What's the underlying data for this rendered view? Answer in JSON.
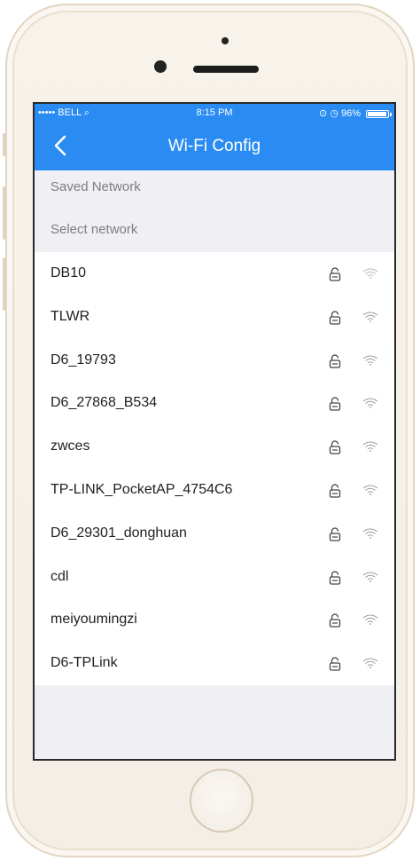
{
  "status_bar": {
    "carrier": "••••• BELL ⌕",
    "time": "8:15 PM",
    "right": "⊙ ◷ 96%"
  },
  "nav": {
    "title": "Wi-Fi Config",
    "back_icon": "chevron-left-icon"
  },
  "sections": {
    "saved": "Saved Network",
    "select": "Select network"
  },
  "networks": [
    {
      "ssid": "DB10"
    },
    {
      "ssid": "TLWR"
    },
    {
      "ssid": "D6_19793"
    },
    {
      "ssid": "D6_27868_B534"
    },
    {
      "ssid": "zwces"
    },
    {
      "ssid": "TP-LINK_PocketAP_4754C6"
    },
    {
      "ssid": "D6_29301_donghuan"
    },
    {
      "ssid": "cdl"
    },
    {
      "ssid": "meiyoumingzi"
    },
    {
      "ssid": "D6-TPLink"
    }
  ],
  "icons": {
    "lock": "lock-icon",
    "wifi": "wifi-icon"
  },
  "colors": {
    "accent": "#2a8cf2",
    "background": "#efeff4"
  }
}
